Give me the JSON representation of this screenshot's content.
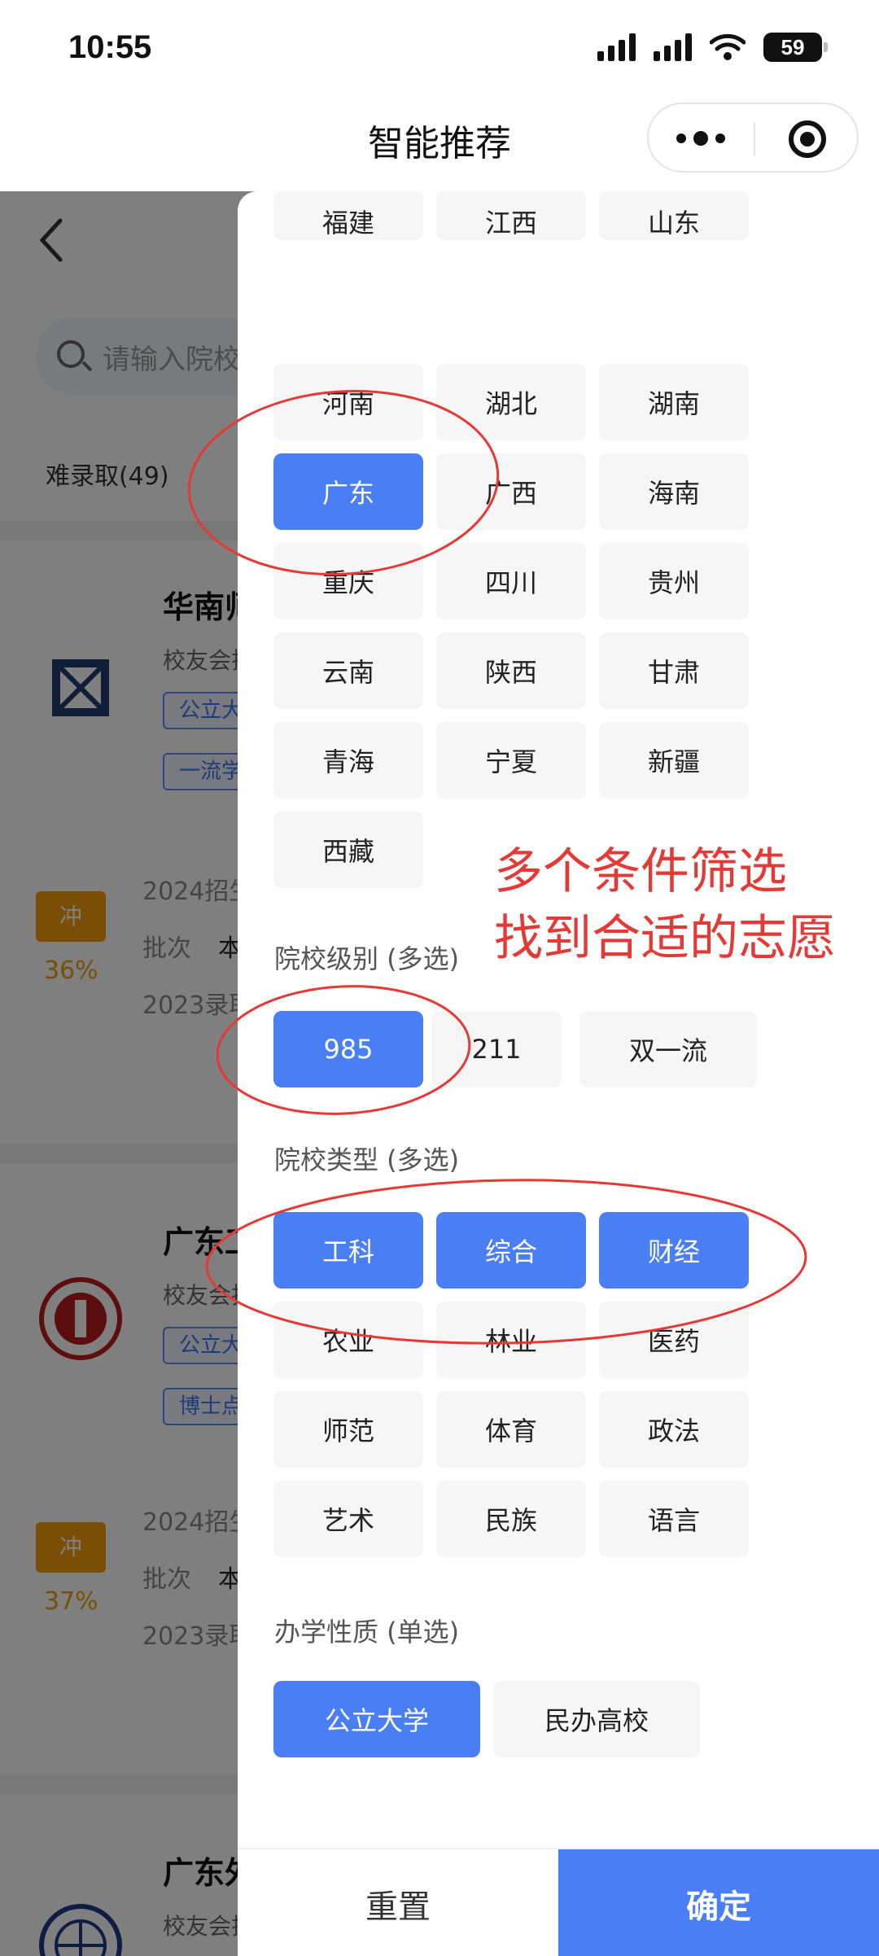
{
  "status_bar": {
    "time": "10:55",
    "battery": "59"
  },
  "nav": {
    "title": "智能推荐"
  },
  "background": {
    "search_placeholder": "请输入院校",
    "tab_hard": "难录取(49)",
    "cards": [
      {
        "name": "华南师",
        "alumni": "校友会排",
        "tags": [
          "公立大",
          "一流学"
        ]
      },
      {
        "name": "广东工",
        "alumni": "校友会排",
        "tags": [
          "公立大",
          "博士点"
        ]
      },
      {
        "name": "广东外",
        "alumni": "校友会排",
        "tags": []
      }
    ],
    "stats": [
      {
        "badge": "冲",
        "percent": "36%",
        "line1": "2024招生",
        "line2_label": "批次",
        "line2_value": "本",
        "line3": "2023录取"
      },
      {
        "badge": "冲",
        "percent": "37%",
        "line1": "2024招生",
        "line2_label": "批次",
        "line2_value": "本",
        "line3": "2023录取"
      }
    ]
  },
  "filter": {
    "provinces_top_cut": [
      "福建",
      "江西",
      "山东"
    ],
    "provinces": [
      {
        "label": "河南",
        "selected": false
      },
      {
        "label": "湖北",
        "selected": false
      },
      {
        "label": "湖南",
        "selected": false
      },
      {
        "label": "广东",
        "selected": true
      },
      {
        "label": "广西",
        "selected": false
      },
      {
        "label": "海南",
        "selected": false
      },
      {
        "label": "重庆",
        "selected": false
      },
      {
        "label": "四川",
        "selected": false
      },
      {
        "label": "贵州",
        "selected": false
      },
      {
        "label": "云南",
        "selected": false
      },
      {
        "label": "陕西",
        "selected": false
      },
      {
        "label": "甘肃",
        "selected": false
      },
      {
        "label": "青海",
        "selected": false
      },
      {
        "label": "宁夏",
        "selected": false
      },
      {
        "label": "新疆",
        "selected": false
      },
      {
        "label": "西藏",
        "selected": false
      }
    ],
    "level": {
      "label": "院校级别 (多选)",
      "options": [
        {
          "label": "985",
          "selected": true
        },
        {
          "label": "211",
          "selected": false
        },
        {
          "label": "双一流",
          "selected": false
        }
      ]
    },
    "type": {
      "label": "院校类型 (多选)",
      "options": [
        {
          "label": "工科",
          "selected": true
        },
        {
          "label": "综合",
          "selected": true
        },
        {
          "label": "财经",
          "selected": true
        },
        {
          "label": "农业",
          "selected": false
        },
        {
          "label": "林业",
          "selected": false
        },
        {
          "label": "医药",
          "selected": false
        },
        {
          "label": "师范",
          "selected": false
        },
        {
          "label": "体育",
          "selected": false
        },
        {
          "label": "政法",
          "selected": false
        },
        {
          "label": "艺术",
          "selected": false
        },
        {
          "label": "民族",
          "selected": false
        },
        {
          "label": "语言",
          "selected": false
        }
      ]
    },
    "nature": {
      "label": "办学性质 (单选)",
      "options": [
        {
          "label": "公立大学",
          "selected": true
        },
        {
          "label": "民办高校",
          "selected": false
        }
      ]
    },
    "reset_label": "重置",
    "confirm_label": "确定"
  },
  "annotation": {
    "line1": "多个条件筛选",
    "line2": "找到合适的志愿",
    "color": "#e53935"
  },
  "colors": {
    "accent": "#4a7ef5",
    "badge": "#f59e0b"
  }
}
